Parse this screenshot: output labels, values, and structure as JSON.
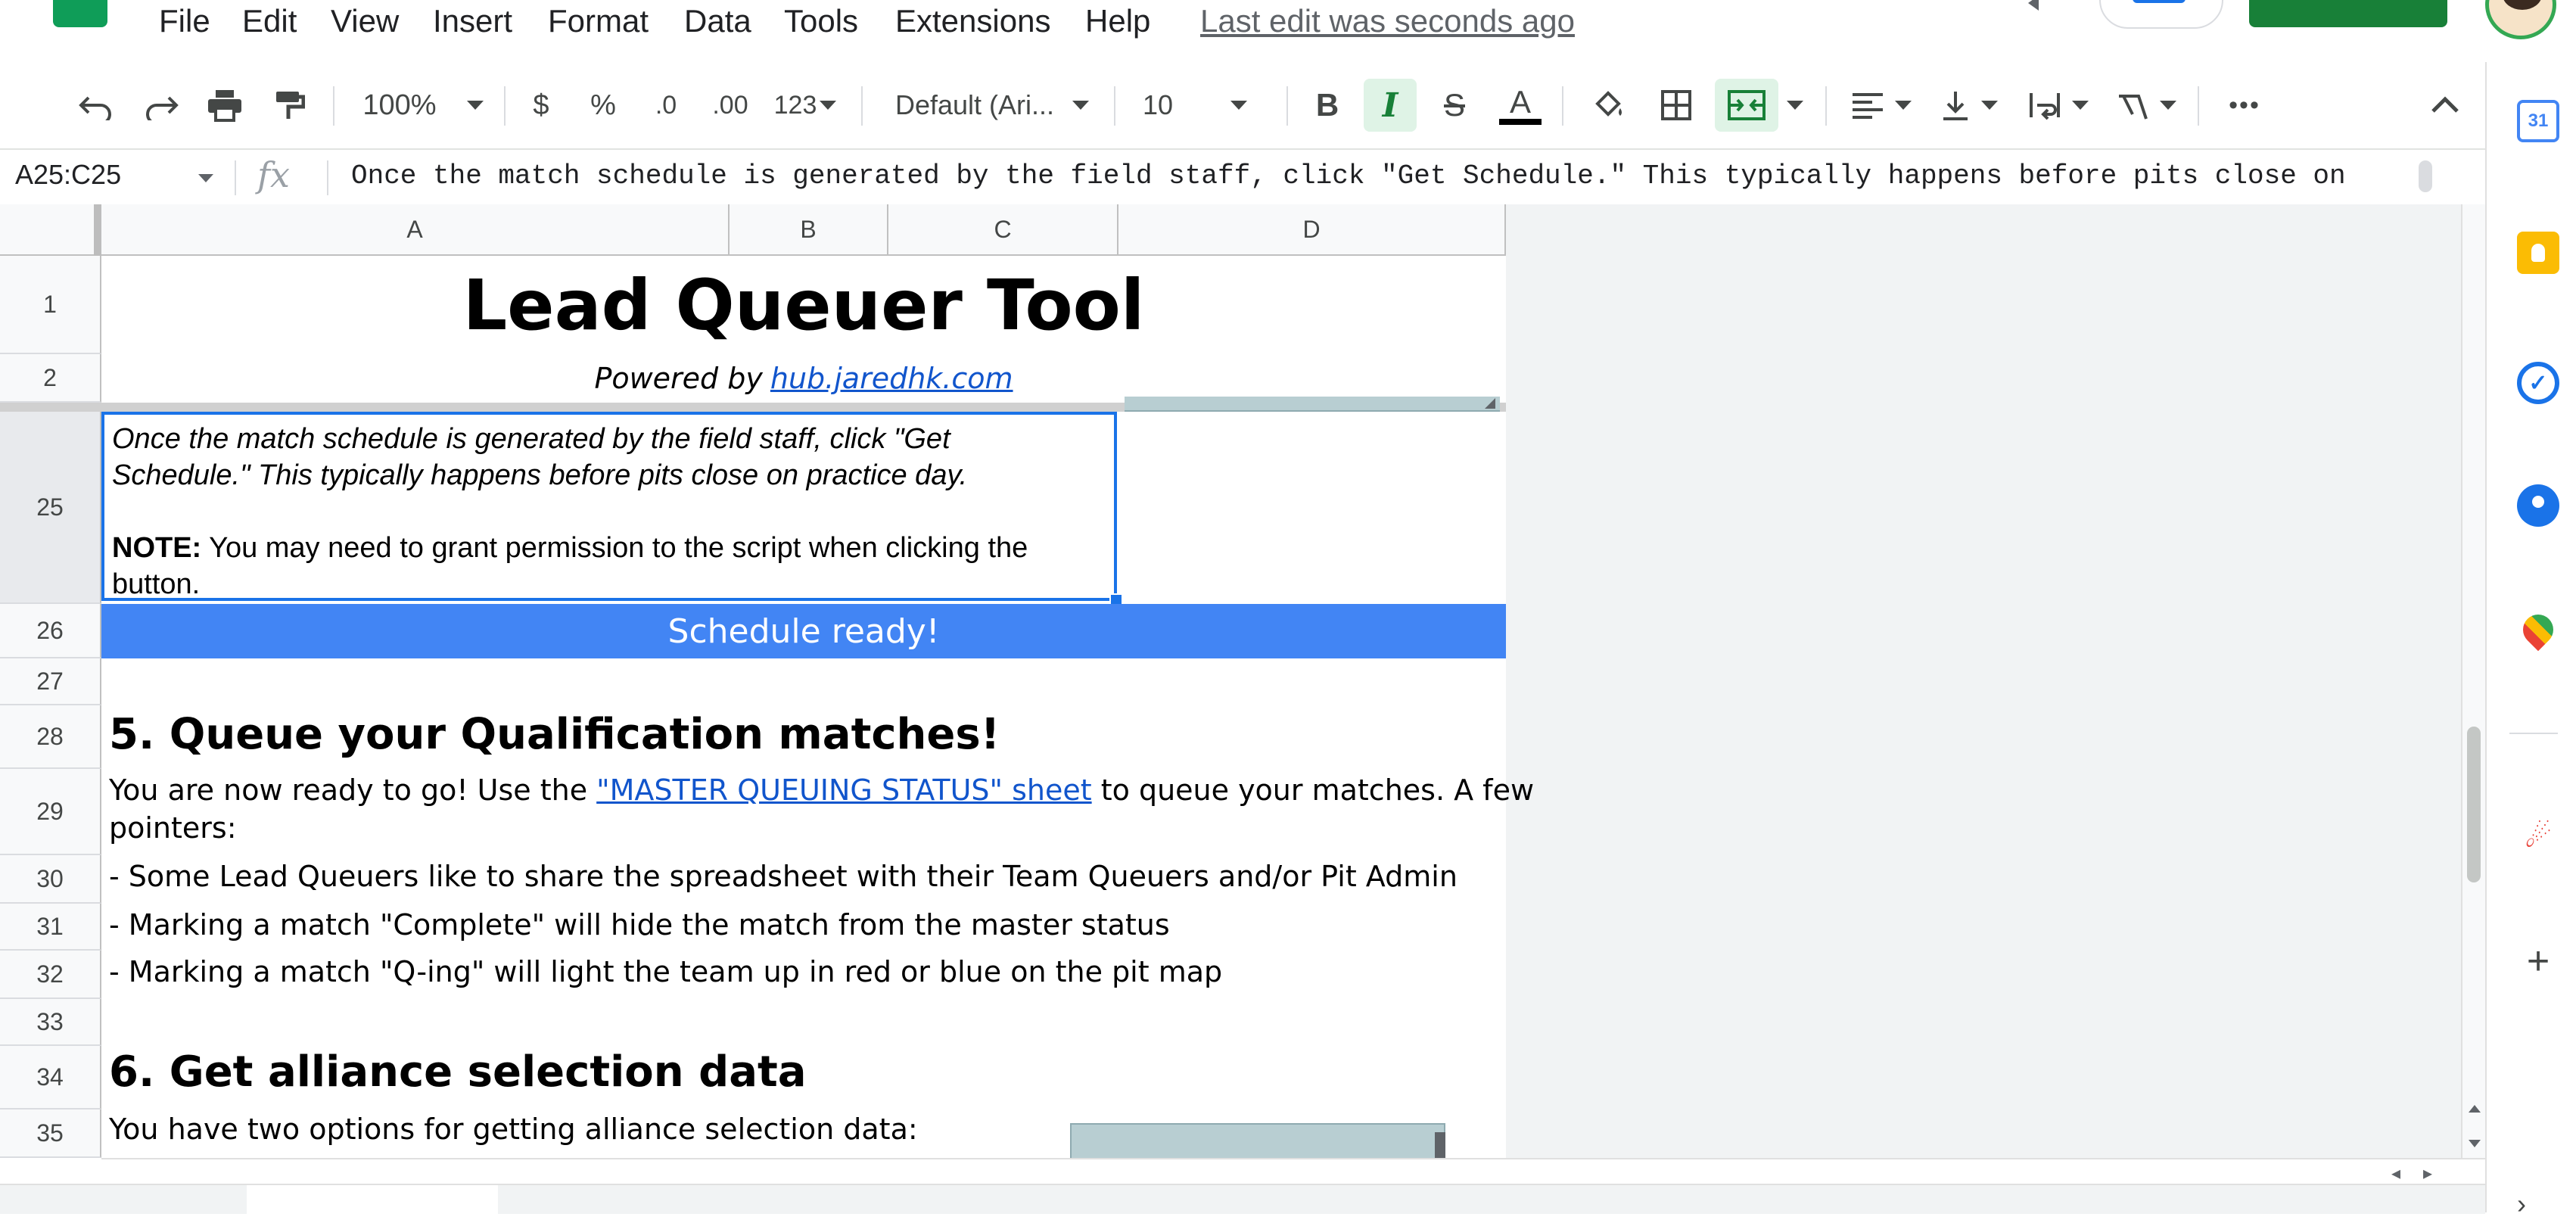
{
  "menu": {
    "items": [
      "File",
      "Edit",
      "View",
      "Insert",
      "Format",
      "Data",
      "Tools",
      "Extensions",
      "Help"
    ],
    "last_edit": "Last edit was seconds ago"
  },
  "toolbar": {
    "zoom": "100%",
    "currency": "$",
    "percent": "%",
    "decrease_decimals": ".0",
    "increase_decimals": ".00",
    "more_formats": "123",
    "font": "Default (Ari...",
    "font_size": "10",
    "bold": "B",
    "italic": "I",
    "strike": "S",
    "text_color": "A",
    "more": "•••"
  },
  "formula_bar": {
    "name_box": "A25:C25",
    "fx": "fx",
    "content": "Once the match schedule is generated by the field staff, click \"Get Schedule.\" This typically happens before pits close on"
  },
  "columns": [
    "A",
    "B",
    "C",
    "D"
  ],
  "rows": [
    "1",
    "2",
    "25",
    "26",
    "27",
    "28",
    "29",
    "30",
    "31",
    "32",
    "33",
    "34",
    "35"
  ],
  "sheet": {
    "title": "Lead Queuer Tool",
    "powered_prefix": "Powered by",
    "powered_link": "hub.jaredhk.com",
    "instructions_line1": "Once the match schedule is generated by the field staff, click \"Get",
    "instructions_line2": "Schedule.\" This typically happens before pits close on practice day.",
    "note_label": "NOTE:",
    "note_text": " You may need to grant permission to the script when clicking the",
    "note_text2": "button.",
    "schedule_status": "Schedule ready!",
    "section5_heading": "5. Queue your Qualification matches!",
    "section5_intro_pre": "You are now ready to go! Use  the ",
    "section5_link": "\"MASTER QUEUING STATUS\" sheet",
    "section5_intro_post": " to queue your matches. A few",
    "section5_intro_line2": "pointers:",
    "bullet1": "- Some Lead Queuers like to share the spreadsheet with their Team Queuers and/or Pit Admin",
    "bullet2": "- Marking a match \"Complete\" will hide the match from the master status",
    "bullet3": "- Marking a match \"Q-ing\" will light the team up in red or blue on the pit map",
    "section6_heading": "6. Get alliance selection data",
    "section6_intro": "You have two options for getting alliance selection data:"
  },
  "side_panel": {
    "calendar_day": "31",
    "icons": [
      "calendar-icon",
      "keep-icon",
      "tasks-icon",
      "contacts-icon",
      "maps-icon",
      "addon-icon",
      "plus-icon",
      "chevron-right-icon"
    ]
  },
  "colors": {
    "accent": "#1a73e8",
    "schedule_bar": "#4285f4",
    "share_button": "#188038",
    "link": "#1155cc"
  }
}
